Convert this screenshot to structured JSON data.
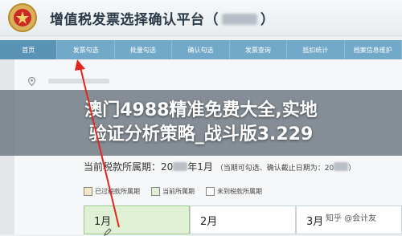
{
  "app": {
    "title": "增值税发票选择确认平台（",
    "title_suffix": "）"
  },
  "nav": {
    "items": [
      {
        "label": "首页",
        "active": true
      },
      {
        "label": "发票勾选",
        "active": false
      },
      {
        "label": "批量勾选",
        "active": false
      },
      {
        "label": "确认勾选",
        "active": false
      },
      {
        "label": "发票查询",
        "active": false
      },
      {
        "label": "抵扣统计",
        "active": false
      },
      {
        "label": "档案信息维护",
        "active": false
      }
    ]
  },
  "banner": {
    "line1": "澳门4988精准免费大全,实地",
    "line2": "验证分析策略_战斗版3.229"
  },
  "period": {
    "label": "当前税款所属期：",
    "year_prefix": "20",
    "month": "年1月",
    "note_open": "（当期可勾选、确认截止日期为：",
    "note_year_prefix": "20",
    "note_close": "）"
  },
  "legend": [
    {
      "label": "已过税款所属期",
      "color": "#f2e6c4"
    },
    {
      "label": "当前所属期",
      "color": "#dff0d4"
    },
    {
      "label": "未到税款所属期",
      "color": "#ffffff"
    }
  ],
  "months": [
    {
      "label": "1月",
      "state": "current"
    },
    {
      "label": "2月",
      "state": "future"
    },
    {
      "label": "3月",
      "state": "future"
    }
  ],
  "watermark": {
    "text": "知乎 @会计友"
  },
  "colors": {
    "nav_bg": "#72a8c8",
    "arrow": "#e0271f",
    "current_period": "#dff0d4"
  }
}
